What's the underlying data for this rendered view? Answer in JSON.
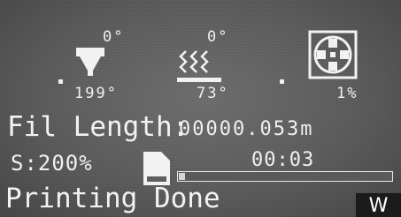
{
  "status": {
    "hotend": {
      "target": "0°",
      "current": "199°"
    },
    "bed": {
      "target": "0°",
      "current": "73°"
    },
    "fan": {
      "speed": "1%"
    }
  },
  "filament": {
    "label": "Fil Length:",
    "value": "00000.053m"
  },
  "print": {
    "speed": "S:200%",
    "elapsed": "00:03",
    "progress": 0.03,
    "message": "Printing Done"
  },
  "watermark": "W",
  "icons": {
    "hotend": "nozzle-icon",
    "bed": "heated-bed-icon",
    "fan": "fan-icon",
    "media": "sd-card-icon"
  },
  "colors": {
    "screen": "#5d5d5d",
    "pixel": "#f0f0f0",
    "badge": "#1b1b1b"
  }
}
